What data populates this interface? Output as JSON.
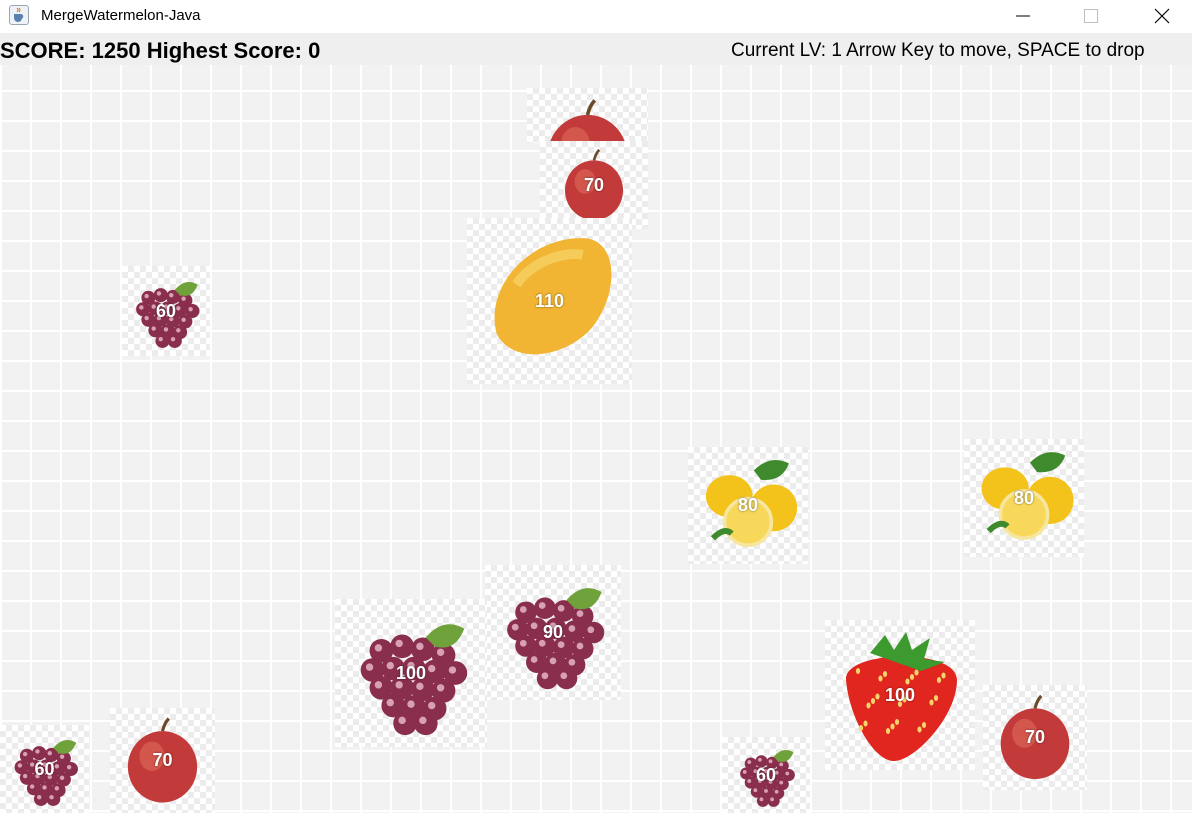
{
  "window": {
    "title": "MergeWatermelon-Java",
    "app_icon": "java-cup-icon",
    "controls": [
      "minimize-icon",
      "maximize-icon",
      "close-icon"
    ]
  },
  "hud": {
    "score_text": "SCORE: 1250  Highest Score: 0",
    "help_text": "Current LV: 1  Arrow Key to move, SPACE to drop"
  },
  "fruits": [
    {
      "kind": "apple",
      "label": ""
    },
    {
      "kind": "apple",
      "label": "70"
    },
    {
      "kind": "mango",
      "label": "110"
    },
    {
      "kind": "grape",
      "label": "60"
    },
    {
      "kind": "lemon",
      "label": "80"
    },
    {
      "kind": "lemon",
      "label": "80"
    },
    {
      "kind": "grape",
      "label": "90"
    },
    {
      "kind": "grape",
      "label": "100"
    },
    {
      "kind": "strawberry",
      "label": "100"
    },
    {
      "kind": "apple",
      "label": "70"
    },
    {
      "kind": "grape",
      "label": "60"
    },
    {
      "kind": "apple",
      "label": "70"
    },
    {
      "kind": "grape",
      "label": "60"
    }
  ]
}
